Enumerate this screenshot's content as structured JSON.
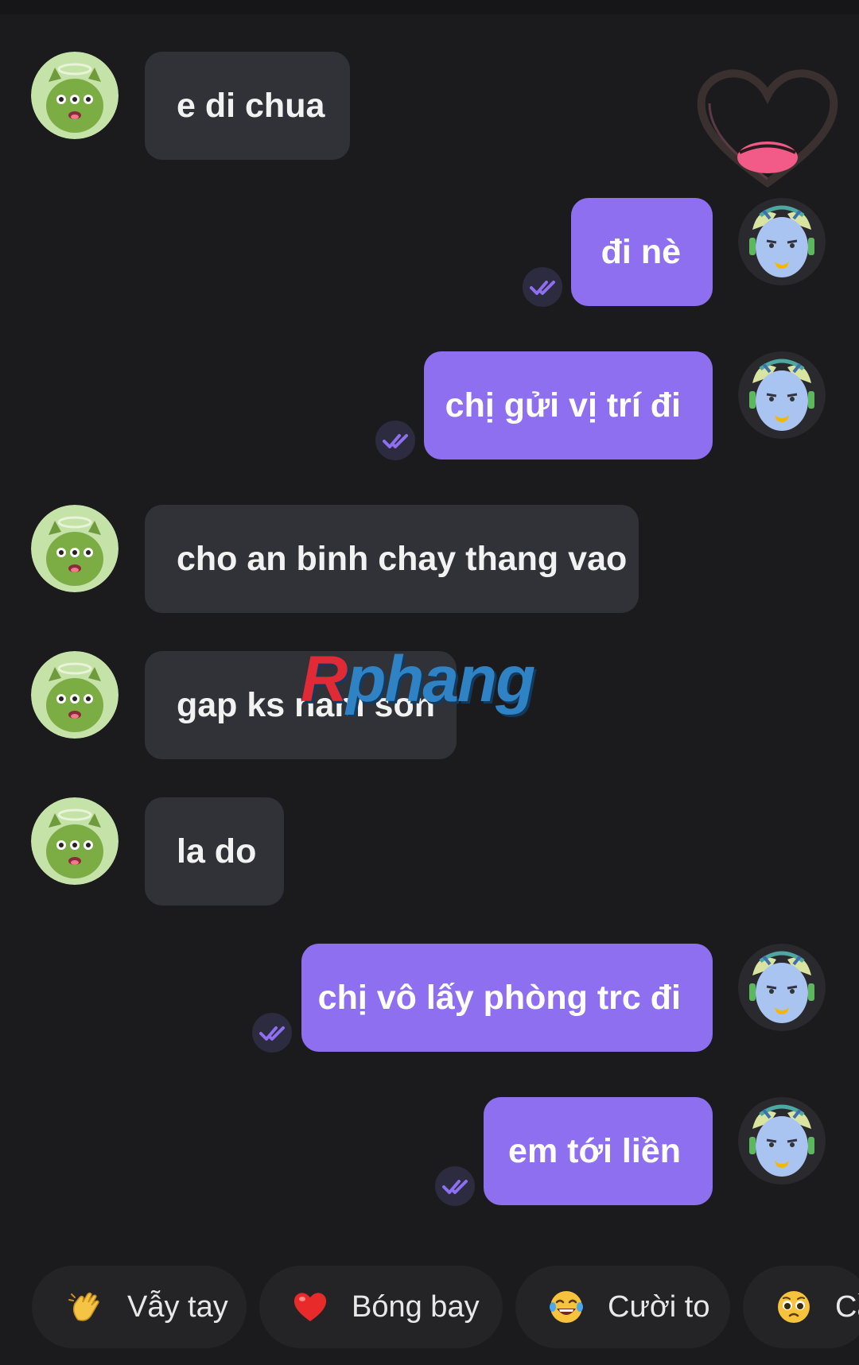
{
  "messages": [
    {
      "text": "e di chua"
    },
    {
      "text": "đi nè"
    },
    {
      "text": "chị gửi vị trí đi"
    },
    {
      "text": "cho an binh chay thang vao"
    },
    {
      "text": "gap ks nam son"
    },
    {
      "text": "la do"
    },
    {
      "text": "chị vô lấy phòng trc đi"
    },
    {
      "text": "em tới liền"
    }
  ],
  "watermark": {
    "first": "R",
    "rest": "phang"
  },
  "reactions": [
    {
      "label": "Vẫy tay",
      "icon": "waving-hand-icon"
    },
    {
      "label": "Bóng bay",
      "icon": "heart-icon"
    },
    {
      "label": "Cười to",
      "icon": "laughing-face-icon"
    },
    {
      "label": "Cầ",
      "icon": "pleading-face-icon"
    }
  ],
  "colors": {
    "background": "#1b1b1d",
    "incoming_bubble": "#313237",
    "outgoing_bubble": "#8d6ff0",
    "chip": "#242427"
  }
}
